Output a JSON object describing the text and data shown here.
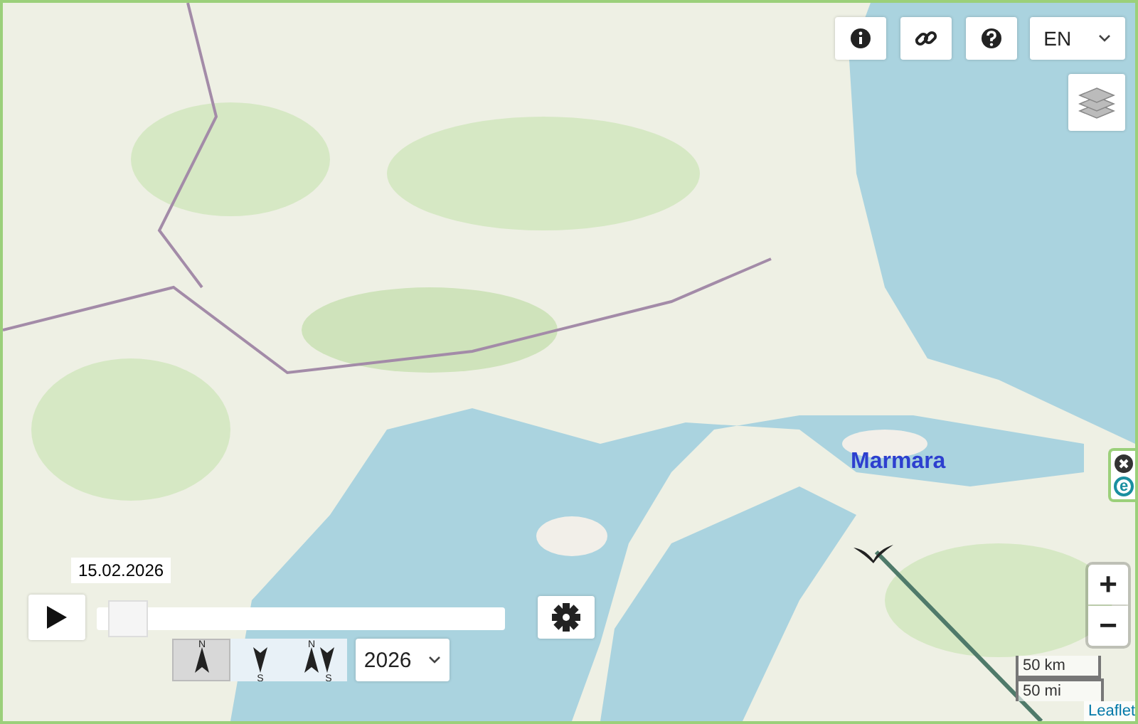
{
  "map": {
    "kind": "picture"
  },
  "toolbar": {
    "buttons": [
      {
        "kind": "info"
      },
      {
        "kind": "link"
      },
      {
        "kind": "help"
      }
    ],
    "language": "EN"
  },
  "layers_button": {
    "kind": "layers"
  },
  "marker": {
    "label": "Marmara"
  },
  "side_widget": {
    "buttons": [
      {
        "kind": "close"
      },
      {
        "kind": "letter",
        "text": "e"
      }
    ]
  },
  "timeline": {
    "date": "15.02.2026",
    "level": 0.03,
    "year": "2026"
  },
  "orientation_modes": [
    {
      "kind": "north",
      "labels": [
        "N"
      ],
      "selected": true
    },
    {
      "kind": "south",
      "labels": [
        "S"
      ],
      "selected": false
    },
    {
      "kind": "both",
      "labels": [
        "N",
        "S"
      ],
      "selected": false
    }
  ],
  "zoom": [
    "+",
    "−"
  ],
  "scale": [
    "50 km",
    "50 mi"
  ],
  "attribution": "Leaflet"
}
